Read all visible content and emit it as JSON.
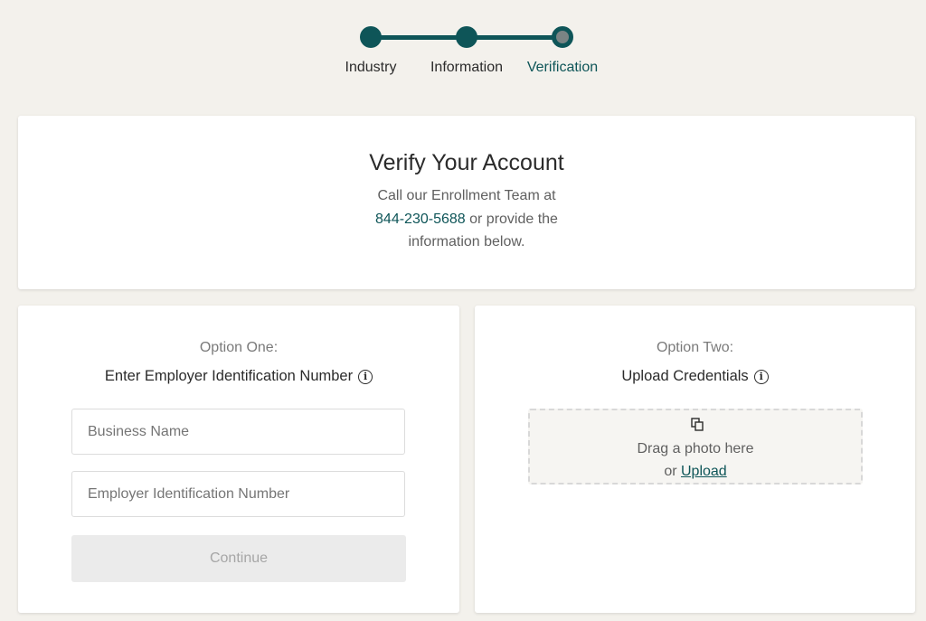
{
  "stepper": {
    "steps": [
      {
        "label": "Industry",
        "state": "complete"
      },
      {
        "label": "Information",
        "state": "complete"
      },
      {
        "label": "Verification",
        "state": "current"
      }
    ]
  },
  "header": {
    "title": "Verify Your Account",
    "line1": "Call our Enrollment Team at",
    "phone": "844-230-5688",
    "line2_suffix": " or provide the",
    "line3": "information below."
  },
  "option_one": {
    "label": "Option One:",
    "title": "Enter Employer Identification Number",
    "info_icon": "info-icon",
    "business_name_placeholder": "Business Name",
    "ein_placeholder": "Employer Identification Number",
    "continue_label": "Continue"
  },
  "option_two": {
    "label": "Option Two:",
    "title": "Upload Credentials",
    "info_icon": "info-icon",
    "drop_icon": "copy-icon",
    "drag_text": "Drag a photo here",
    "or_text": "or ",
    "upload_label": "Upload"
  },
  "colors": {
    "accent": "#0e5558",
    "background": "#f3f1ec",
    "disabled_button": "#ebebeb"
  }
}
